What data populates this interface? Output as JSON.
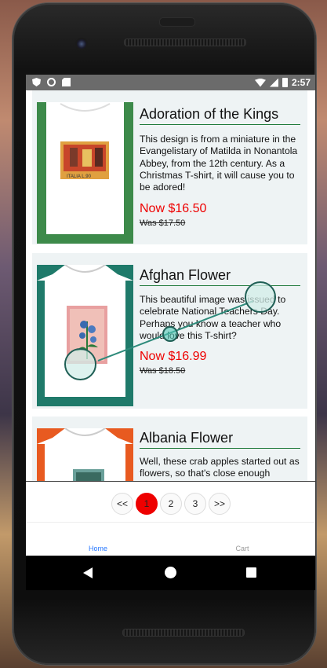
{
  "status": {
    "time": "2:57"
  },
  "products": [
    {
      "title": "Adoration of the Kings",
      "description": "This design is from a miniature in the Evangelistary of Matilda in Nonantola Abbey, from the 12th century. As a Christmas T-shirt, it will cause you to be adored!",
      "now_price": "Now $16.50",
      "was_price": "Was $17.50",
      "stamp_text": "ITALIA  L.90",
      "trim_color": "#3d8a4a"
    },
    {
      "title": "Afghan Flower",
      "description": "This beautiful image was issued to celebrate National Teachers Day. Perhaps you know a teacher who would love this T-shirt?",
      "now_price": "Now $16.99",
      "was_price": "Was $18.50",
      "trim_color": "#1f7a6a"
    },
    {
      "title": "Albania Flower",
      "description": "Well, these crab apples started out as flowers, so that's close enough",
      "trim_color": "#e85a20"
    }
  ],
  "pagination": {
    "prev": "<<",
    "pages": [
      "1",
      "2",
      "3"
    ],
    "next": ">>",
    "active_page": "1"
  },
  "tabs": {
    "home": "Home",
    "cart": "Cart"
  },
  "colors": {
    "accent": "#1f7a3a",
    "price": "#ee0000",
    "tab_active": "#2979ff",
    "page_active": "#ee0000"
  },
  "icons": {
    "back": "back-triangle-icon",
    "home": "home-circle-icon",
    "recent": "recent-apps-square-icon"
  }
}
